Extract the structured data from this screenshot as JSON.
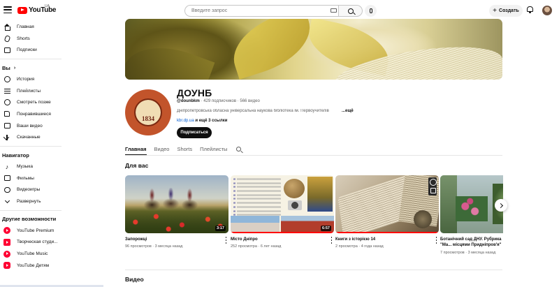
{
  "topbar": {
    "logo_text": "YouTube",
    "logo_region": "UA",
    "search_placeholder": "Введите запрос",
    "create_label": "Создать"
  },
  "sidebar": {
    "main_items": [
      {
        "label": "Главная",
        "icon": "home-icon"
      },
      {
        "label": "Shorts",
        "icon": "shorts-icon"
      },
      {
        "label": "Подписки",
        "icon": "subscriptions-icon"
      }
    ],
    "you_title": "Вы",
    "you_items": [
      {
        "label": "История",
        "icon": "history-icon"
      },
      {
        "label": "Плейлисты",
        "icon": "playlists-icon"
      },
      {
        "label": "Смотреть позже",
        "icon": "watch-later-icon"
      },
      {
        "label": "Понравившиеся",
        "icon": "like-icon"
      },
      {
        "label": "Ваши видео",
        "icon": "your-videos-icon"
      },
      {
        "label": "Скачанные",
        "icon": "download-icon"
      }
    ],
    "navigator_title": "Навигатор",
    "navigator_items": [
      {
        "label": "Музыка",
        "icon": "music-icon"
      },
      {
        "label": "Фильмы",
        "icon": "film-icon"
      },
      {
        "label": "Видеоигры",
        "icon": "gamepad-icon"
      },
      {
        "label": "Развернуть",
        "icon": "chevron-down-icon"
      }
    ],
    "more_title": "Другие возможности",
    "more_items": [
      {
        "label": "YouTube Premium",
        "icon": "youtube-premium-icon"
      },
      {
        "label": "Творческая студи...",
        "icon": "youtube-studio-icon"
      },
      {
        "label": "YouTube Music",
        "icon": "youtube-music-icon"
      },
      {
        "label": "YouTube Детям",
        "icon": "youtube-kids-icon"
      }
    ]
  },
  "channel": {
    "name": "ДОУНБ",
    "handle": "@dounbkm",
    "meta_rest": " · 429 подписчиков · 566 видео",
    "description": "Дніпропетровська обласна універсальна наукова бібліотека ім. Первоучителів",
    "more_label": "...ещё",
    "link": "kbr.dp.ua",
    "extra_links": " и ещё 3 ссылки",
    "subscribe_label": "Подписаться",
    "logo_year": "1834"
  },
  "tabs": [
    "Главная",
    "Видео",
    "Shorts",
    "Плейлисты"
  ],
  "sections": {
    "for_you": "Для вас",
    "videos": "Видео"
  },
  "videos": [
    {
      "title": "Запорожці",
      "views": "96 просмотров",
      "age": "3 месяца назад",
      "duration": "3:17",
      "progress": 0
    },
    {
      "title": "Місто Дніпро",
      "views": "252 просмотра",
      "age": "6 лет назад",
      "duration": "6:57",
      "progress": 1.0
    },
    {
      "title": "Книги з історією 14",
      "views": "2 просмотра",
      "age": "4 года назад",
      "duration": "",
      "progress": 1.0
    },
    {
      "title": "Ботанічний сад ДНУ. Рубрика \"Ма... місцями Придніпров'я\"",
      "views": "7 просмотров",
      "age": "3 месяца назад",
      "duration": "",
      "progress": 0
    }
  ]
}
